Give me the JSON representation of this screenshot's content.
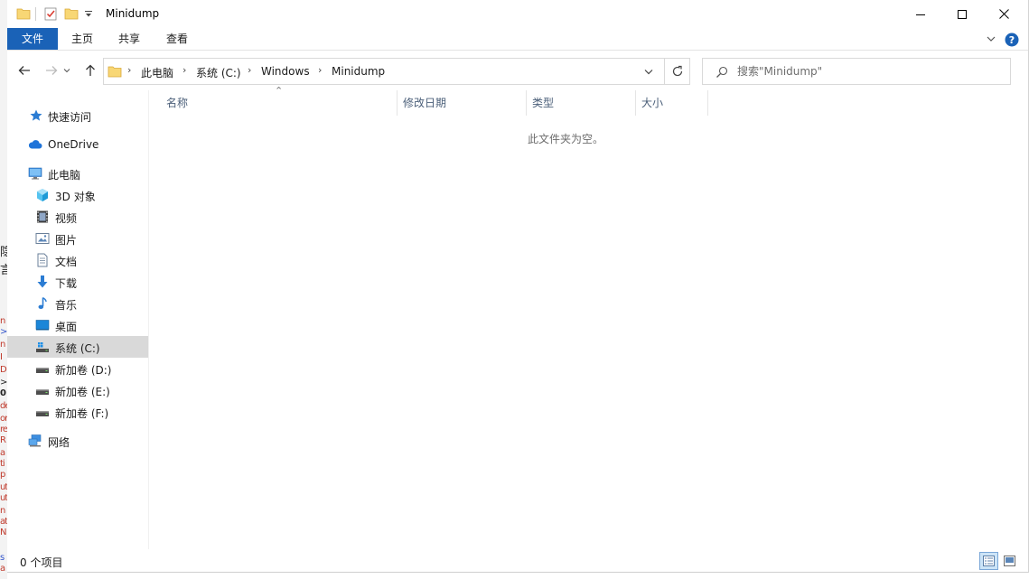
{
  "window": {
    "title": "Minidump"
  },
  "ribbon": {
    "tabs": [
      {
        "label": "文件"
      },
      {
        "label": "主页"
      },
      {
        "label": "共享"
      },
      {
        "label": "查看"
      }
    ]
  },
  "address": {
    "breadcrumb": [
      "此电脑",
      "系统 (C:)",
      "Windows",
      "Minidump"
    ]
  },
  "search": {
    "placeholder": "搜索\"Minidump\""
  },
  "nav": {
    "items": [
      {
        "label": "快速访问",
        "icon": "star-icon"
      },
      {
        "label": "OneDrive",
        "icon": "cloud-icon"
      },
      {
        "label": "此电脑",
        "icon": "computer-icon"
      },
      {
        "label": "3D 对象",
        "icon": "cube-icon"
      },
      {
        "label": "视频",
        "icon": "video-icon"
      },
      {
        "label": "图片",
        "icon": "picture-icon"
      },
      {
        "label": "文档",
        "icon": "document-icon"
      },
      {
        "label": "下载",
        "icon": "download-icon"
      },
      {
        "label": "音乐",
        "icon": "music-icon"
      },
      {
        "label": "桌面",
        "icon": "desktop-icon"
      },
      {
        "label": "系统 (C:)",
        "icon": "system-drive-icon",
        "selected": true
      },
      {
        "label": "新加卷 (D:)",
        "icon": "drive-icon"
      },
      {
        "label": "新加卷 (E:)",
        "icon": "drive-icon"
      },
      {
        "label": "新加卷 (F:)",
        "icon": "drive-icon"
      },
      {
        "label": "网络",
        "icon": "network-icon"
      }
    ]
  },
  "columns": [
    {
      "label": "名称"
    },
    {
      "label": "修改日期"
    },
    {
      "label": "类型"
    },
    {
      "label": "大小"
    }
  ],
  "content": {
    "empty_message": "此文件夹为空。"
  },
  "status": {
    "item_count": "0 个项目"
  },
  "colors": {
    "accent": "#1a62b7",
    "selected": "#d9d9d9",
    "folder": "#f8d775",
    "header_text": "#4c607a"
  }
}
